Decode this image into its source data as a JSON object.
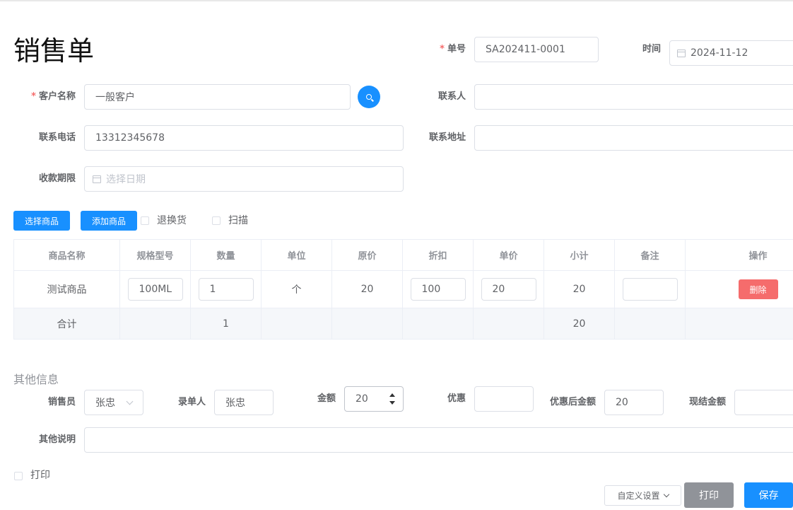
{
  "header": {
    "title": "销售单"
  },
  "form": {
    "order_no": {
      "label": "单号",
      "value": "SA202411-0001"
    },
    "time": {
      "label": "时间",
      "value": "2024-11-12"
    },
    "customer": {
      "label": "客户名称",
      "value": "一般客户"
    },
    "contact": {
      "label": "联系人",
      "value": ""
    },
    "phone": {
      "label": "联系电话",
      "value": "13312345678"
    },
    "address": {
      "label": "联系地址",
      "value": ""
    },
    "due": {
      "label": "收款期限",
      "placeholder": "选择日期"
    }
  },
  "toolbar": {
    "select_goods": "选择商品",
    "add_goods": "添加商品",
    "return_exchange": "退换货",
    "scan": "扫描"
  },
  "table": {
    "headers": [
      "商品名称",
      "规格型号",
      "数量",
      "单位",
      "原价",
      "折扣",
      "单价",
      "小计",
      "备注",
      "操作"
    ],
    "rows": [
      {
        "name": "测试商品",
        "spec": "100ML",
        "qty": "1",
        "unit": "个",
        "orig_price": "20",
        "discount": "100",
        "price": "20",
        "subtotal": "20",
        "remark": "",
        "action": "删除"
      }
    ],
    "total": {
      "label": "合计",
      "qty": "1",
      "subtotal": "20"
    }
  },
  "other": {
    "section_title": "其他信息",
    "salesman": {
      "label": "销售员",
      "value": "张忠"
    },
    "creator": {
      "label": "录单人",
      "value": "张忠"
    },
    "amount": {
      "label": "金额",
      "value": "20"
    },
    "discount": {
      "label": "优惠",
      "value": ""
    },
    "after_discount": {
      "label": "优惠后金额",
      "value": "20"
    },
    "cash": {
      "label": "现结金额",
      "value": ""
    },
    "note": {
      "label": "其他说明",
      "value": ""
    },
    "print": "打印"
  },
  "footer": {
    "custom_settings": "自定义设置",
    "print": "打印",
    "save": "保存"
  },
  "colors": {
    "primary": "#1890ff",
    "danger": "#f56c6c",
    "required": "#f56c6c",
    "gray_button": "#909399"
  }
}
